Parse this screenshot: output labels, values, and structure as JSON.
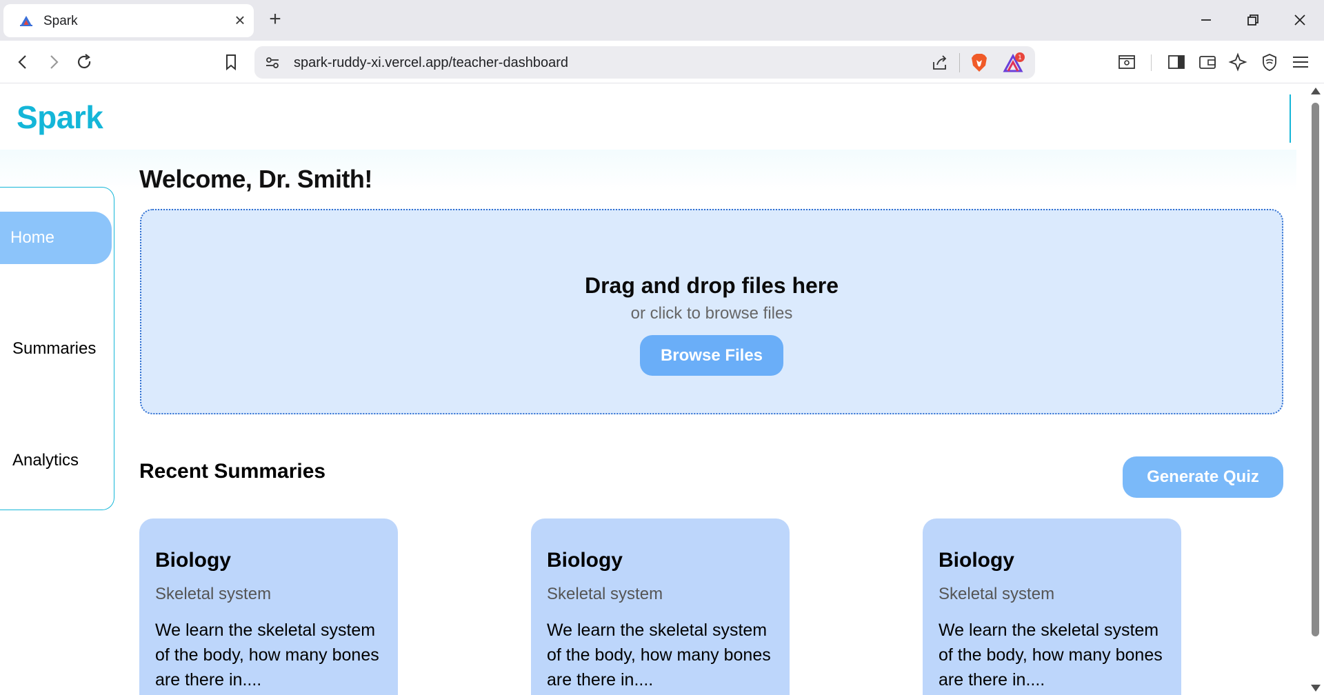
{
  "browser": {
    "tab_title": "Spark",
    "url": "spark-ruddy-xi.vercel.app/teacher-dashboard",
    "new_tab_glyph": "+",
    "close_tab_glyph": "×",
    "notification_count": "1",
    "icons": [
      "back-icon",
      "forward-icon",
      "reload-icon",
      "bookmark-icon",
      "site-settings-icon",
      "share-icon",
      "brave-shield-icon",
      "rewards-icon",
      "reader-mode-icon",
      "sidebar-icon",
      "wallet-icon",
      "leo-ai-icon",
      "vpn-icon",
      "menu-icon"
    ]
  },
  "app": {
    "logo": "Spark",
    "accent": "#14b6d8"
  },
  "sidebar": {
    "items": [
      {
        "label": "Home",
        "active": true
      },
      {
        "label": "Summaries",
        "active": false
      },
      {
        "label": "Analytics",
        "active": false
      }
    ]
  },
  "main": {
    "welcome": "Welcome, Dr. Smith!",
    "dropzone": {
      "title": "Drag and drop files here",
      "subtitle": "or click to browse files",
      "button": "Browse Files"
    },
    "recent_title": "Recent Summaries",
    "quiz_button": "Generate Quiz",
    "cards": [
      {
        "title": "Biology",
        "subtitle": "Skeletal system",
        "body": "We learn the skeletal system of the body, how many bones are there in...."
      },
      {
        "title": "Biology",
        "subtitle": "Skeletal system",
        "body": "We learn the skeletal system of the body, how many bones are there in...."
      },
      {
        "title": "Biology",
        "subtitle": "Skeletal system",
        "body": "We learn the skeletal system of the body, how many bones are there in...."
      }
    ]
  }
}
